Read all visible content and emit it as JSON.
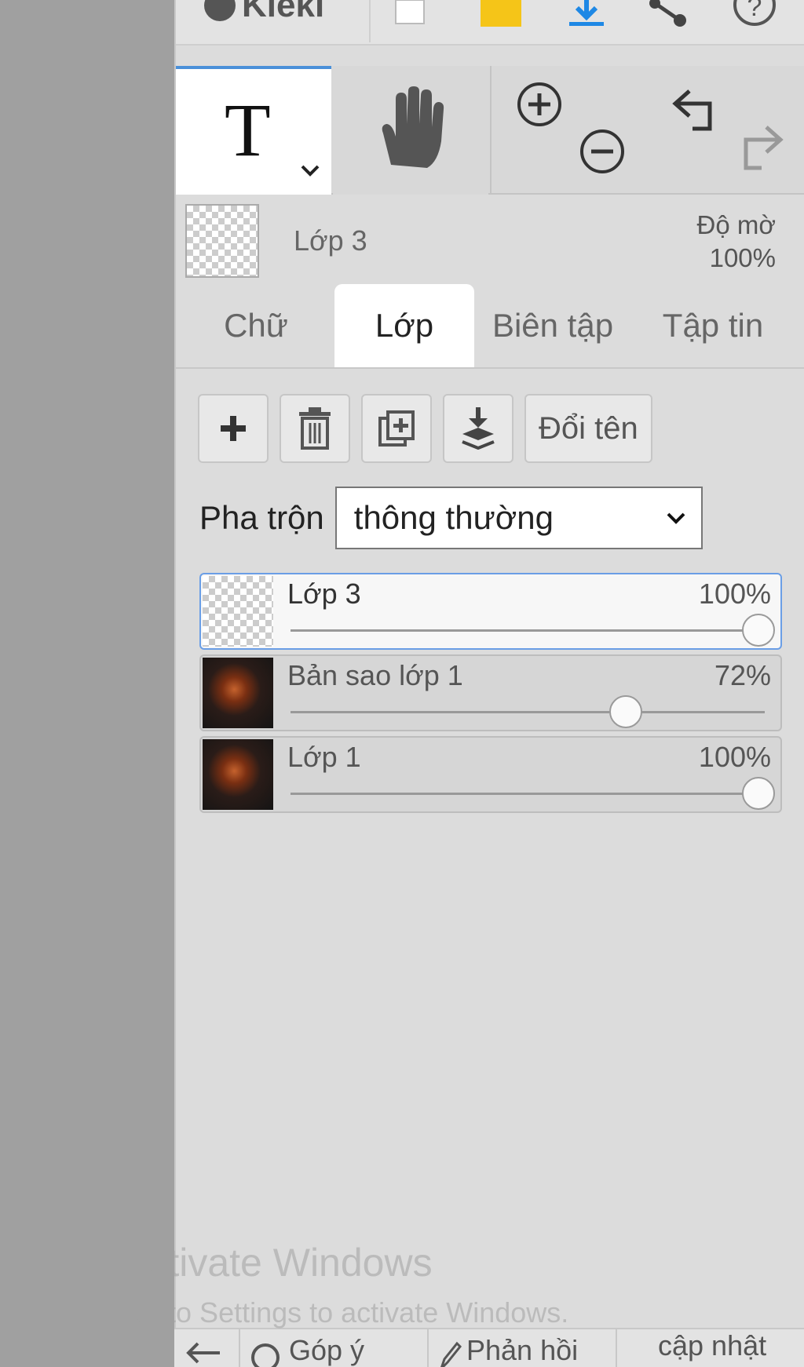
{
  "app": {
    "logo_text": "Kleki"
  },
  "colors": {
    "accent": "#4a90d9",
    "selected_border": "#6a9ee6",
    "panel_bg": "#dcdcdc",
    "canvas_bg": "#a0a0a0"
  },
  "topbar": {
    "icons": [
      "kleki-logo-icon",
      "new-image-icon",
      "open-folder-icon",
      "download-icon",
      "share-icon",
      "help-icon"
    ]
  },
  "tools": {
    "active_tool_label": "T",
    "icons": [
      "text-tool-icon",
      "chevron-down-icon",
      "hand-tool-icon",
      "zoom-in-icon",
      "zoom-out-icon",
      "undo-icon",
      "redo-icon"
    ]
  },
  "current_layer": {
    "name": "Lớp 3",
    "opacity_label": "Độ mờ",
    "opacity_value": "100%"
  },
  "tabs": [
    {
      "label": "Chữ",
      "active": false
    },
    {
      "label": "Lớp",
      "active": true
    },
    {
      "label": "Biên tập",
      "active": false
    },
    {
      "label": "Tập tin",
      "active": false
    }
  ],
  "layer_buttons": {
    "icons": [
      "add-layer-icon",
      "delete-layer-icon",
      "duplicate-layer-icon",
      "merge-down-icon"
    ],
    "rename_label": "Đổi tên"
  },
  "blend": {
    "label": "Pha trộn",
    "selected": "thông thường"
  },
  "layers": [
    {
      "name": "Lớp 3",
      "opacity_text": "100%",
      "opacity": 1.0,
      "selected": true,
      "thumb": "transparent"
    },
    {
      "name": "Bản sao lớp 1",
      "opacity_text": "72%",
      "opacity": 0.72,
      "selected": false,
      "thumb": "photo"
    },
    {
      "name": "Lớp 1",
      "opacity_text": "100%",
      "opacity": 1.0,
      "selected": false,
      "thumb": "photo"
    }
  ],
  "watermark": {
    "title": "Activate Windows",
    "subtitle": "Go to Settings to activate Windows."
  },
  "bottombar": {
    "item1": "Góp ý",
    "item2": "Phản hồi",
    "item3": "cập nhật"
  }
}
